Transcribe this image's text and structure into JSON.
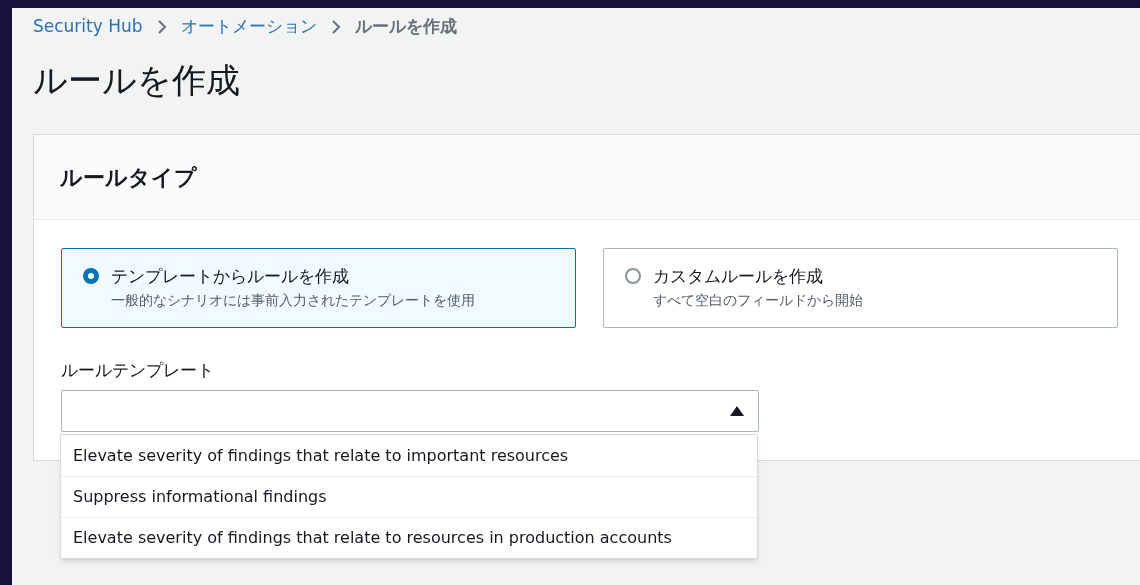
{
  "breadcrumbs": [
    {
      "label": "Security Hub",
      "link": true
    },
    {
      "label": "オートメーション",
      "link": true
    },
    {
      "label": "ルールを作成",
      "link": false
    }
  ],
  "page_title": "ルールを作成",
  "rule_type": {
    "title": "ルールタイプ",
    "options": [
      {
        "label": "テンプレートからルールを作成",
        "description": "一般的なシナリオには事前入力されたテンプレートを使用",
        "selected": true
      },
      {
        "label": "カスタムルールを作成",
        "description": "すべて空白のフィールドから開始",
        "selected": false
      }
    ]
  },
  "rule_template": {
    "label": "ルールテンプレート",
    "expanded": true,
    "options": [
      "Elevate severity of findings that relate to important resources",
      "Suppress informational findings",
      "Elevate severity of findings that relate to resources in production accounts"
    ]
  }
}
